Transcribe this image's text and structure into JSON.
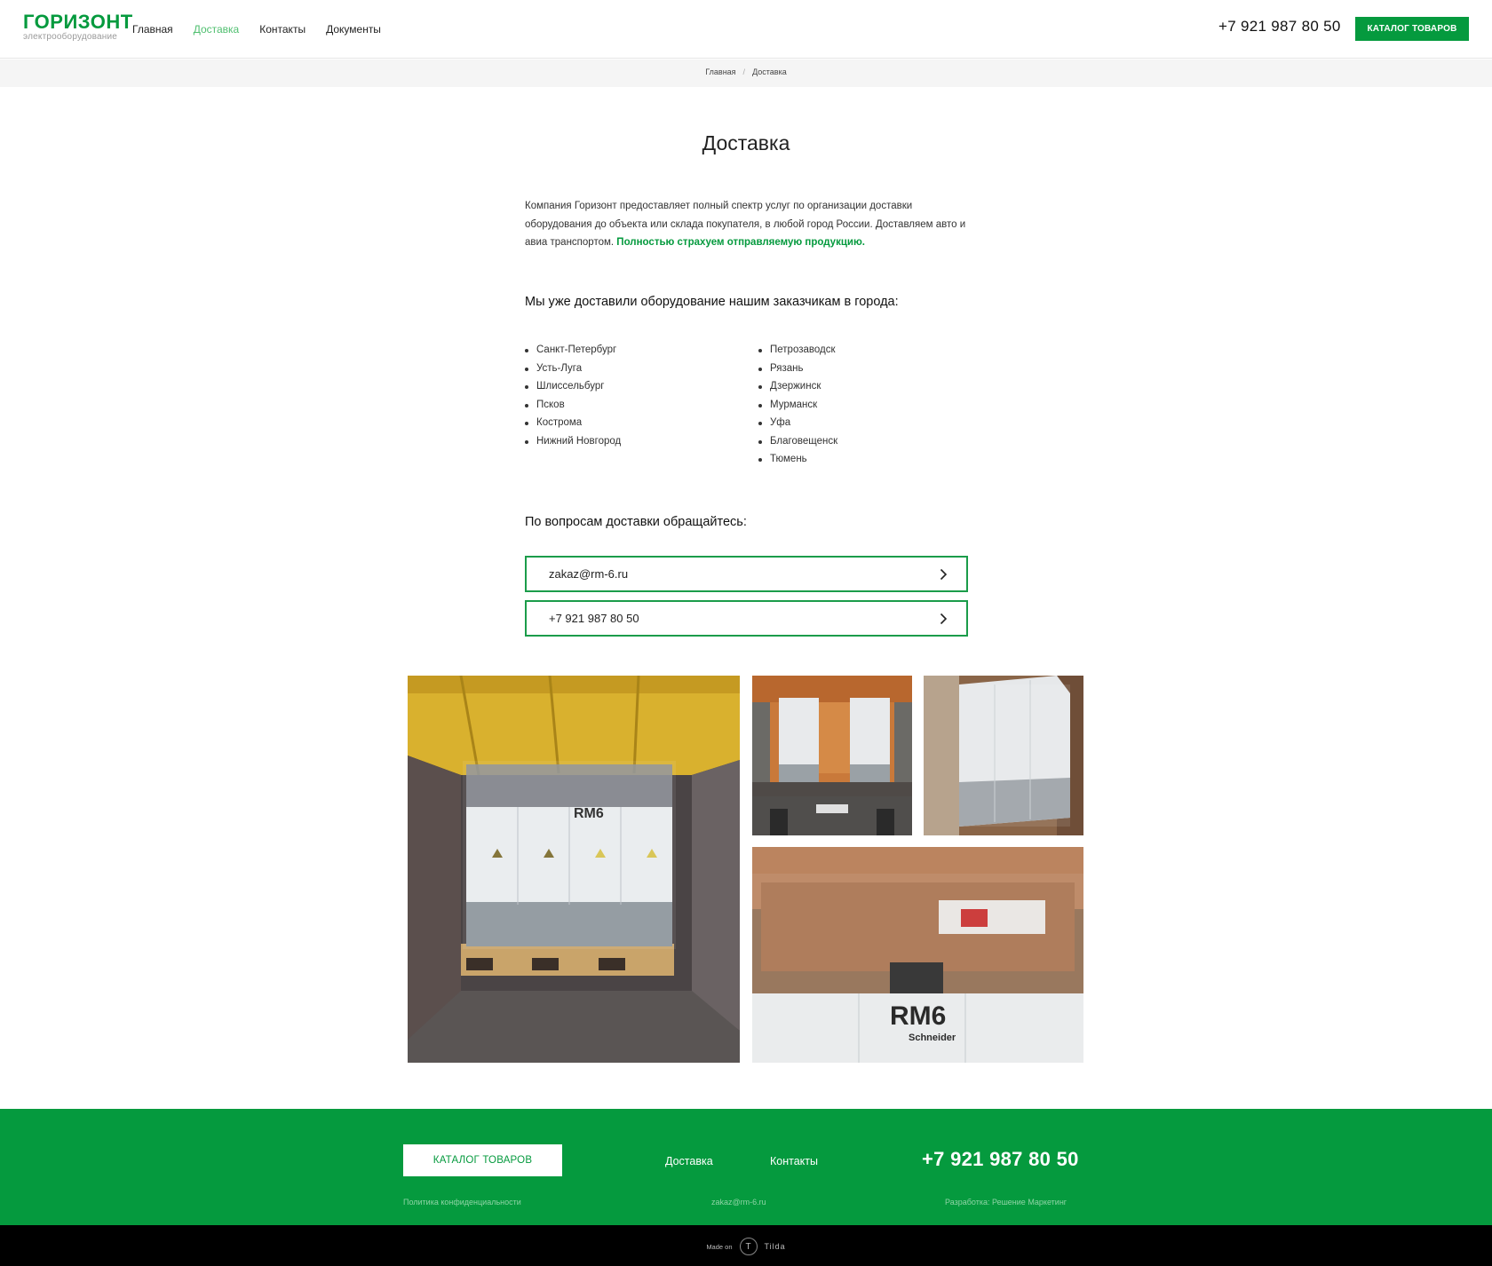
{
  "header": {
    "logo_title": "ГОРИЗОНТ",
    "logo_subtitle": "электрооборудование",
    "nav": [
      {
        "label": "Главная",
        "active": false
      },
      {
        "label": "Доставка",
        "active": true
      },
      {
        "label": "Контакты",
        "active": false
      },
      {
        "label": "Документы",
        "active": false
      }
    ],
    "phone": "+7 921 987 80 50",
    "catalog_button": "КАТАЛОГ ТОВАРОВ"
  },
  "breadcrumbs": {
    "home": "Главная",
    "separator": "/",
    "current": "Доставка"
  },
  "main": {
    "title": "Доставка",
    "intro_text": "Компания Горизонт предоставляет полный спектр услуг по организации доставки оборудования до объекта или склада покупателя, в любой город России. Доставляем авто и авиа транспортом.",
    "intro_highlight": "Полностью страхуем отправляемую продукцию.",
    "cities_heading": "Мы уже доставили оборудование нашим заказчикам в города:",
    "cities_left": [
      "Санкт-Петербург",
      "Усть-Луга",
      "Шлиссельбург",
      "Псков",
      "Кострома",
      "Нижний Новгород"
    ],
    "cities_right": [
      "Петрозаводск",
      "Рязань",
      "Дзержинск",
      "Мурманск",
      "Уфа",
      "Благовещенск",
      "Тюмень"
    ],
    "contact_heading": "По вопросам доставки обращайтесь:",
    "contact_email": "zakaz@rm-6.ru",
    "contact_phone": "+7 921 987 80 50"
  },
  "photos": {
    "label_rm6": "RM6",
    "label_brand": "Schneider"
  },
  "footer": {
    "catalog_button": "КАТАЛОГ ТОВАРОВ",
    "link_delivery": "Доставка",
    "link_contacts": "Контакты",
    "phone": "+7 921 987 80 50",
    "policy": "Политика конфиденциальности",
    "email": "zakaz@rm-6.ru",
    "developer": "Разработка: Решение Маркетинг"
  },
  "tilda": {
    "made_on": "Made on",
    "logo_letter": "T",
    "name": "Tilda"
  },
  "colors": {
    "brand_green": "#059a3e",
    "nav_active": "#4fbf6f"
  }
}
